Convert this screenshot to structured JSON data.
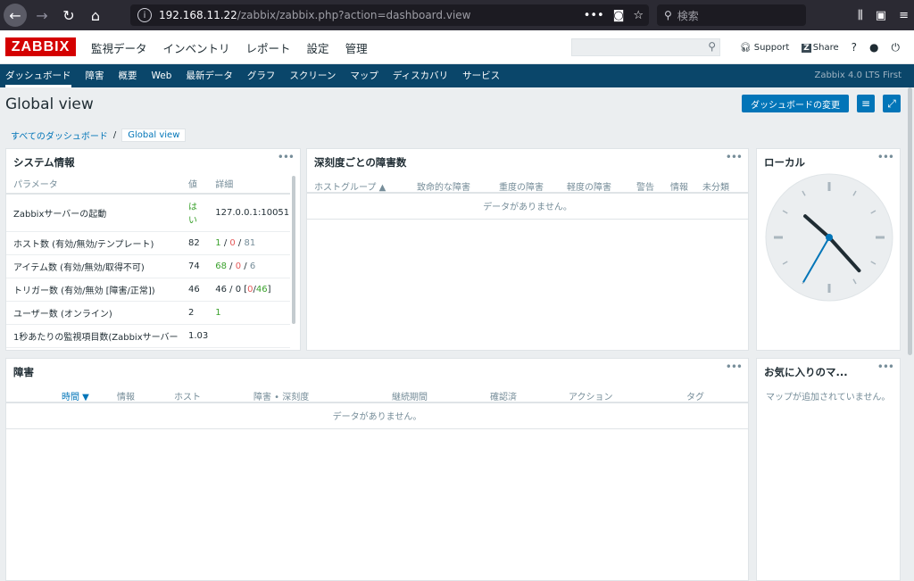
{
  "browser": {
    "url_host": "192.168.11.22",
    "url_path": "/zabbix/zabbix.php?action=dashboard.view",
    "search_placeholder": "検索"
  },
  "header": {
    "logo": "ZABBIX",
    "menu": [
      "監視データ",
      "インベントリ",
      "レポート",
      "設定",
      "管理"
    ],
    "support": "Support",
    "share": "Share",
    "share_badge": "Z",
    "help": "?"
  },
  "subnav": {
    "items": [
      "ダッシュボード",
      "障害",
      "概要",
      "Web",
      "最新データ",
      "グラフ",
      "スクリーン",
      "マップ",
      "ディスカバリ",
      "サービス"
    ],
    "selected": "ダッシュボード",
    "version": "Zabbix 4.0 LTS First"
  },
  "page": {
    "title": "Global view",
    "edit_button": "ダッシュボードの変更",
    "breadcrumb_all": "すべてのダッシュボード",
    "breadcrumb_sep": "/",
    "breadcrumb_current": "Global view"
  },
  "system_info": {
    "title": "システム情報",
    "columns": [
      "パラメータ",
      "値",
      "詳細"
    ],
    "rows": [
      {
        "param": "Zabbixサーバーの起動",
        "value": "はい",
        "detail": "127.0.0.1:10051"
      },
      {
        "param": "ホスト数 (有効/無効/テンプレート)",
        "value": "82",
        "d1": "1",
        "d2": "0",
        "d3": "81"
      },
      {
        "param": "アイテム数 (有効/無効/取得不可)",
        "value": "74",
        "d1": "68",
        "d2": "0",
        "d3": "6"
      },
      {
        "param": "トリガー数 (有効/無効 [障害/正常])",
        "value": "46",
        "d_pre": "46 / 0 [",
        "d1": "0",
        "d2": "46",
        "d_post": "]"
      },
      {
        "param": "ユーザー数 (オンライン)",
        "value": "2",
        "detail": "1"
      },
      {
        "param": "1秒あたりの監視項目数(Zabbixサーバー",
        "value": "1.03",
        "detail": ""
      }
    ]
  },
  "severity": {
    "title": "深刻度ごとの障害数",
    "columns": [
      "ホストグループ ▲",
      "致命的な障害",
      "重度の障害",
      "軽度の障害",
      "警告",
      "情報",
      "未分類"
    ],
    "no_data": "データがありません。"
  },
  "clock": {
    "title": "ローカル",
    "hour": 10,
    "minute": 23,
    "second": 35
  },
  "problems": {
    "title": "障害",
    "columns": [
      "時間 ▼",
      "情報",
      "ホスト",
      "障害 • 深刻度",
      "継続期間",
      "確認済",
      "アクション",
      "タグ"
    ],
    "no_data": "データがありません。"
  },
  "favorites": {
    "title": "お気に入りのマ...",
    "empty": "マップが追加されていません。"
  },
  "widget_menu": "•••",
  "colors": {
    "brand": "#d40000",
    "nav": "#0a466a",
    "accent": "#0275b8",
    "ok": "#3aa12c",
    "bad": "#e45959"
  }
}
